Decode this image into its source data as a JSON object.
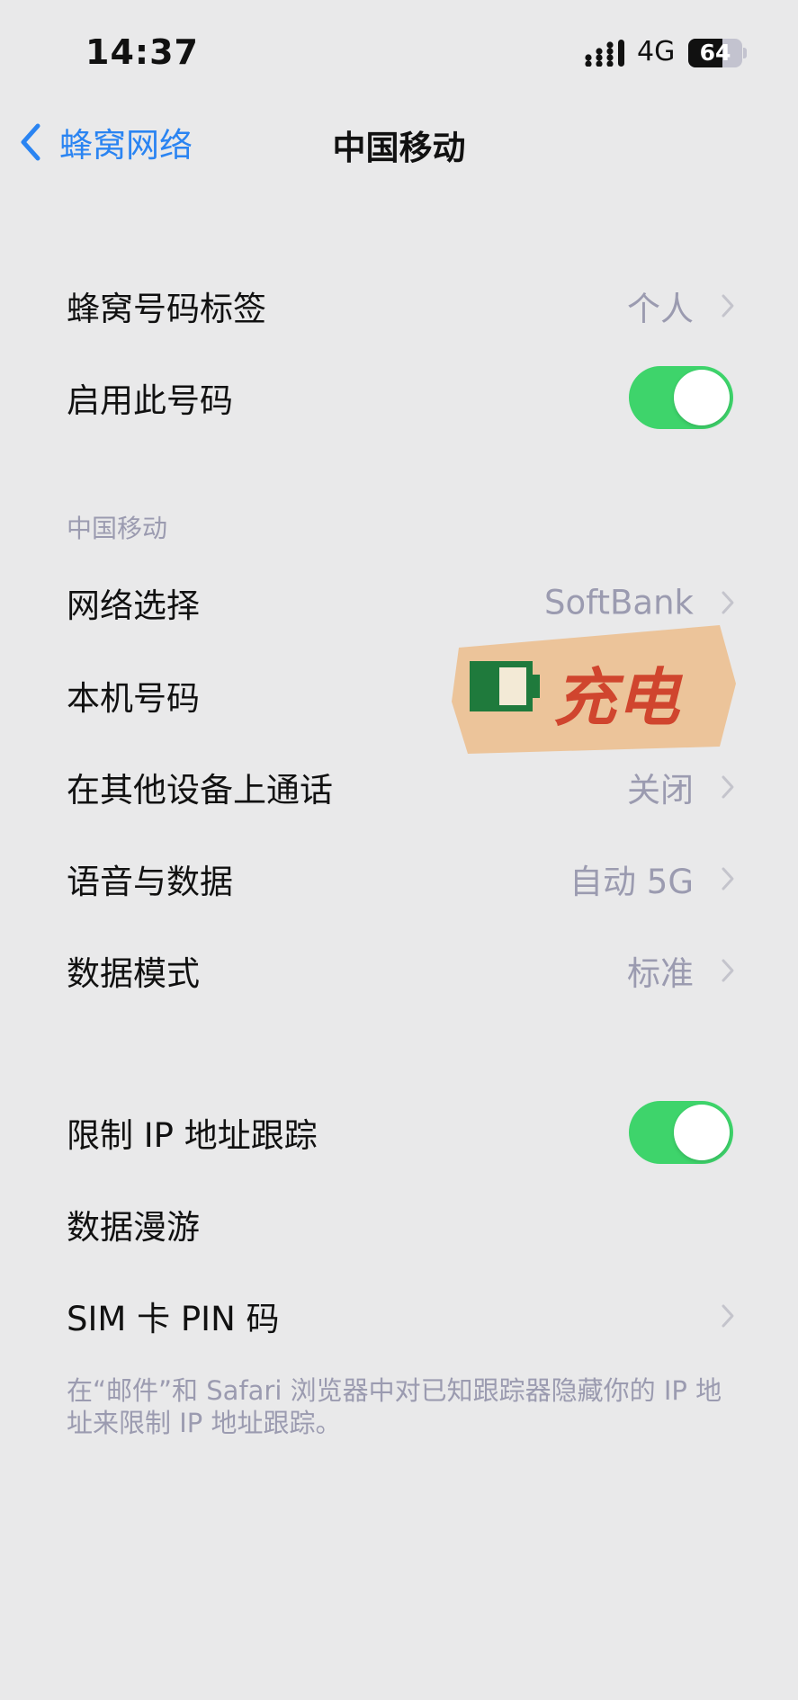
{
  "status": {
    "time": "14:37",
    "network": "4G",
    "battery": 64
  },
  "nav": {
    "back_label": "蜂窝网络",
    "title": "中国移动"
  },
  "group1": [
    {
      "label": "蜂窝号码标签",
      "value": "个人",
      "chevron": true
    },
    {
      "label": "启用此号码",
      "toggle_on": true
    }
  ],
  "group2": {
    "header": "中国移动",
    "rows": [
      {
        "label": "网络选择",
        "value": "SoftBank",
        "chevron": true
      },
      {
        "label": "本机号码"
      },
      {
        "label": "在其他设备上通话",
        "value": "关闭",
        "chevron": true
      },
      {
        "label": "语音与数据",
        "value": "自动 5G",
        "chevron": true
      },
      {
        "label": "数据模式",
        "value": "标准",
        "chevron": true
      }
    ]
  },
  "group3": {
    "rows": [
      {
        "label": "限制 IP 地址跟踪",
        "toggle_on": true
      },
      {
        "label": "数据漫游"
      },
      {
        "label": "SIM 卡 PIN 码",
        "chevron": true
      }
    ],
    "footer": "在“邮件”和 Safari 浏览器中对已知跟踪器隐藏你的 IP 地址来限制 IP 地址跟踪。"
  },
  "sticker": {
    "text": "充电"
  },
  "colors": {
    "accent": "#2a84f2",
    "toggle_on": "#3ed46b",
    "secondary_text": "#9b9bb0",
    "background": "#e9e9ea"
  }
}
